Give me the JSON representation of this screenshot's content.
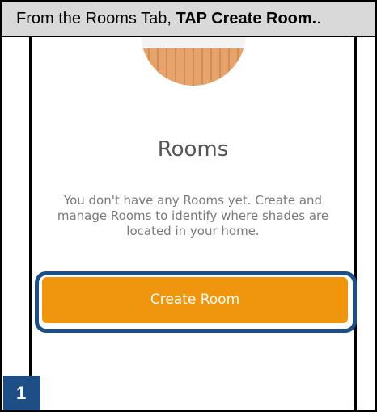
{
  "instruction": {
    "prefix": "From the Rooms Tab, ",
    "action": "TAP Create Room.",
    "suffix": "."
  },
  "screen": {
    "title": "Rooms",
    "description": "You don't have any Rooms yet. Create and manage Rooms to identify where shades are located in your home.",
    "create_button_label": "Create Room",
    "illustration_icon": "room-illustration-icon"
  },
  "step": {
    "number": "1"
  },
  "colors": {
    "accent": "#f0960e",
    "highlight": "#1d4f86",
    "instruction_bg": "#d9d9d9"
  }
}
